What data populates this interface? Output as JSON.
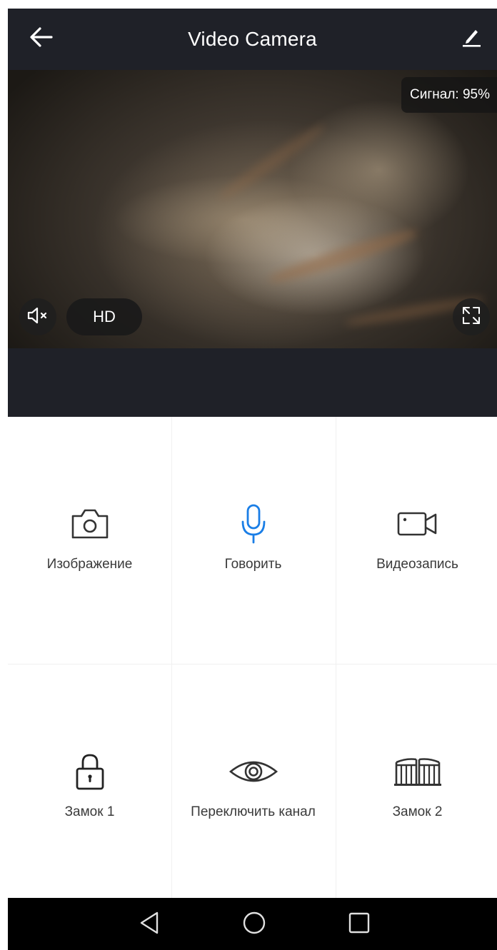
{
  "header": {
    "title": "Video Camera",
    "back_icon": "arrow-left-icon",
    "edit_icon": "pencil-icon"
  },
  "video": {
    "signal_label": "Сигнал: 95%",
    "quality_label": "HD",
    "mute_icon": "speaker-muted-icon",
    "fullscreen_icon": "expand-icon"
  },
  "actions": [
    {
      "label": "Изображение",
      "icon": "camera-icon",
      "color": "#333333"
    },
    {
      "label": "Говорить",
      "icon": "microphone-icon",
      "color": "#1a7ee6"
    },
    {
      "label": "Видеозапись",
      "icon": "video-camera-icon",
      "color": "#333333"
    },
    {
      "label": "Замок 1",
      "icon": "padlock-icon",
      "color": "#333333"
    },
    {
      "label": "Переключить канал",
      "icon": "eye-icon",
      "color": "#333333"
    },
    {
      "label": "Замок 2",
      "icon": "gate-icon",
      "color": "#333333"
    }
  ],
  "navbar": {
    "back_icon": "triangle-back-icon",
    "home_icon": "circle-home-icon",
    "recents_icon": "square-recents-icon"
  },
  "colors": {
    "header_bg": "#1f2128",
    "accent_blue": "#1a7ee6",
    "navbar_bg": "#000000"
  }
}
